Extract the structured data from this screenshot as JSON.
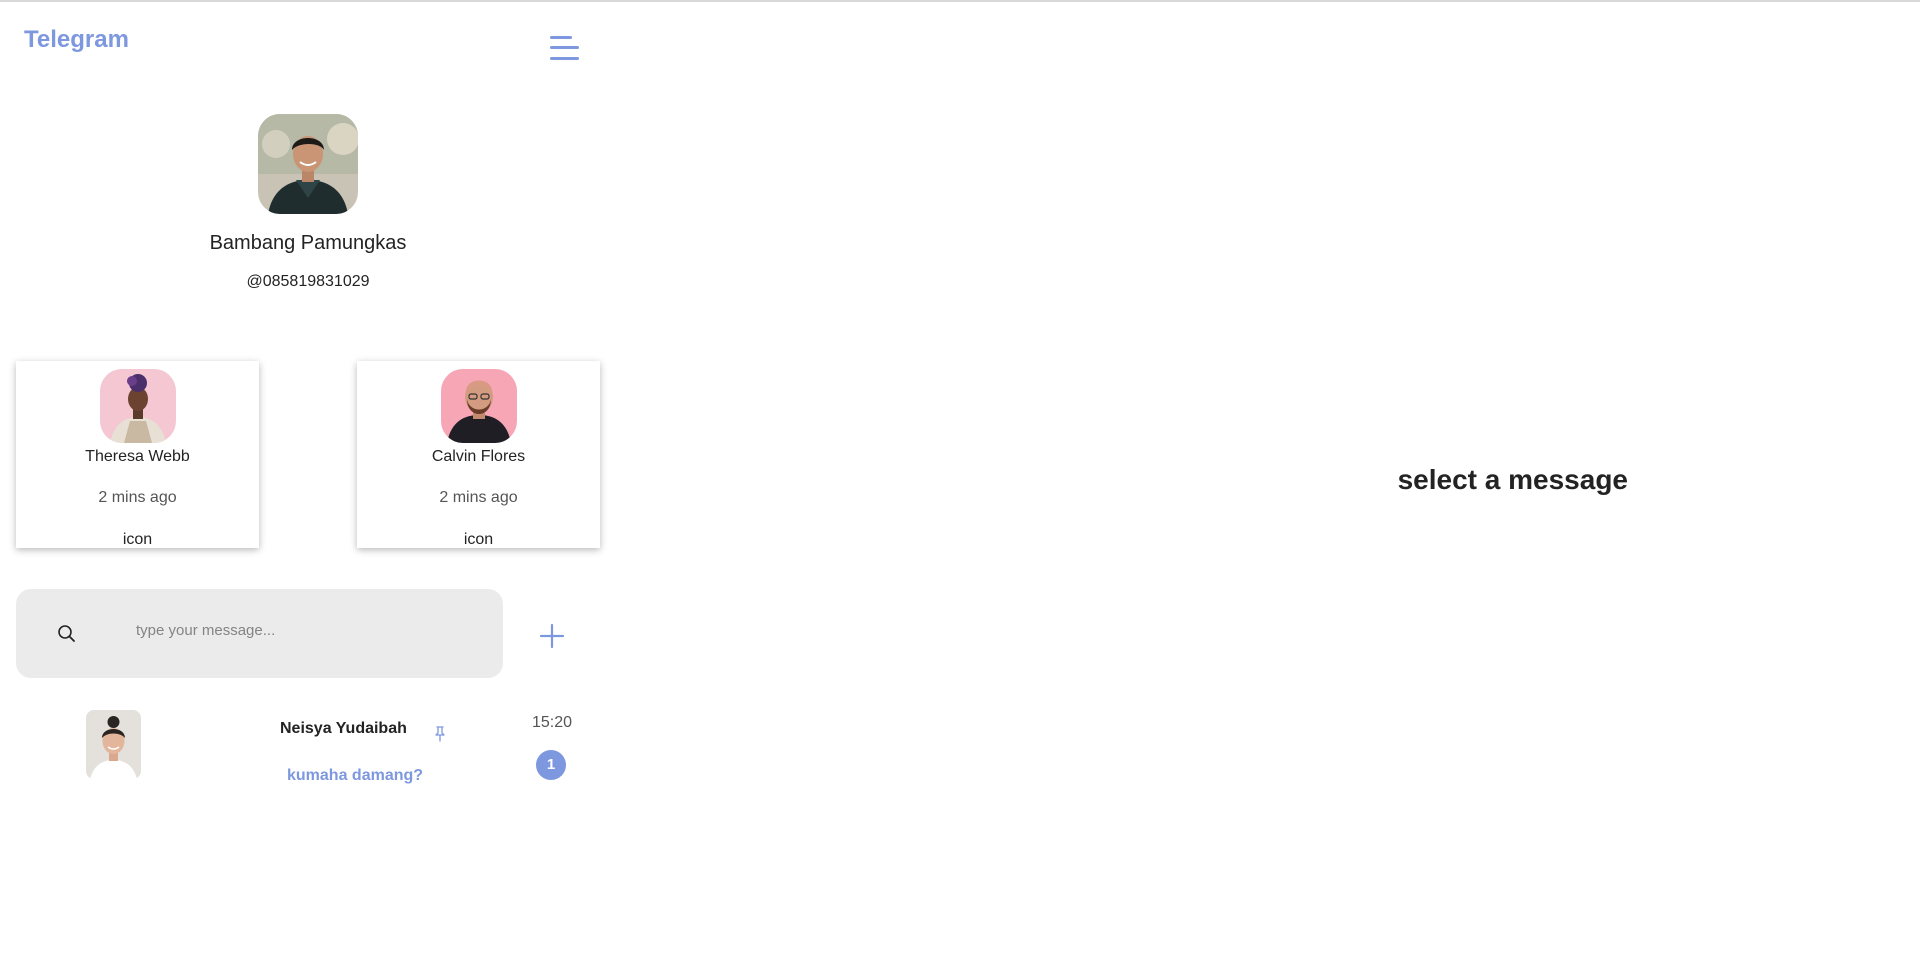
{
  "app": {
    "title": "Telegram",
    "accent": "#7e98df"
  },
  "profile": {
    "name": "Bambang Pamungkas",
    "handle": "@085819831029"
  },
  "stories": [
    {
      "name": "Theresa Webb",
      "time": "2 mins ago",
      "icon_label": "icon"
    },
    {
      "name": "Calvin Flores",
      "time": "2 mins ago",
      "icon_label": "icon"
    }
  ],
  "search": {
    "placeholder": "type your message..."
  },
  "chats": [
    {
      "name": "Neisya Yudaibah",
      "message": "kumaha damang?",
      "time": "15:20",
      "unread": "1",
      "pinned": true
    }
  ],
  "main": {
    "placeholder": "select a message"
  }
}
